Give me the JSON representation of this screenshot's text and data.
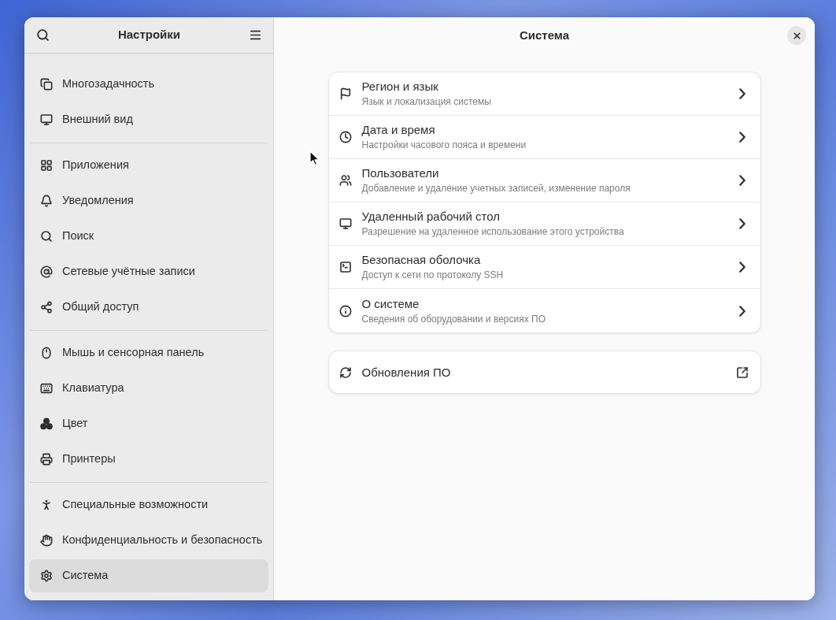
{
  "sidebar": {
    "title": "Настройки",
    "groups": [
      {
        "items": [
          {
            "label": "Многозадачность",
            "selected": false
          },
          {
            "label": "Внешний вид",
            "selected": false
          }
        ]
      },
      {
        "items": [
          {
            "label": "Приложения",
            "selected": false
          },
          {
            "label": "Уведомления",
            "selected": false
          },
          {
            "label": "Поиск",
            "selected": false
          },
          {
            "label": "Сетевые учётные записи",
            "selected": false
          },
          {
            "label": "Общий доступ",
            "selected": false
          }
        ]
      },
      {
        "items": [
          {
            "label": "Мышь и сенсорная панель",
            "selected": false
          },
          {
            "label": "Клавиатура",
            "selected": false
          },
          {
            "label": "Цвет",
            "selected": false
          },
          {
            "label": "Принтеры",
            "selected": false
          }
        ]
      },
      {
        "items": [
          {
            "label": "Специальные возможности",
            "selected": false
          },
          {
            "label": "Конфиденциальность и безопасность",
            "selected": false
          },
          {
            "label": "Система",
            "selected": true
          }
        ]
      }
    ]
  },
  "page": {
    "title": "Система",
    "sections": [
      {
        "rows": [
          {
            "kind": "subpage",
            "title": "Регион и язык",
            "subtitle": "Язык и локализация системы"
          },
          {
            "kind": "subpage",
            "title": "Дата и время",
            "subtitle": "Настройки часового пояса и времени"
          },
          {
            "kind": "subpage",
            "title": "Пользователи",
            "subtitle": "Добавление и удаление учетных записей, изменение пароля"
          },
          {
            "kind": "subpage",
            "title": "Удаленный рабочий стол",
            "subtitle": "Разрешение на удаленное использование этого устройства"
          },
          {
            "kind": "subpage",
            "title": "Безопасная оболочка",
            "subtitle": "Доступ к сети по протоколу SSH"
          },
          {
            "kind": "subpage",
            "title": "О системе",
            "subtitle": "Сведения об оборудовании и версиях ПО"
          }
        ]
      },
      {
        "rows": [
          {
            "kind": "external",
            "title": "Обновления ПО"
          }
        ]
      }
    ]
  }
}
